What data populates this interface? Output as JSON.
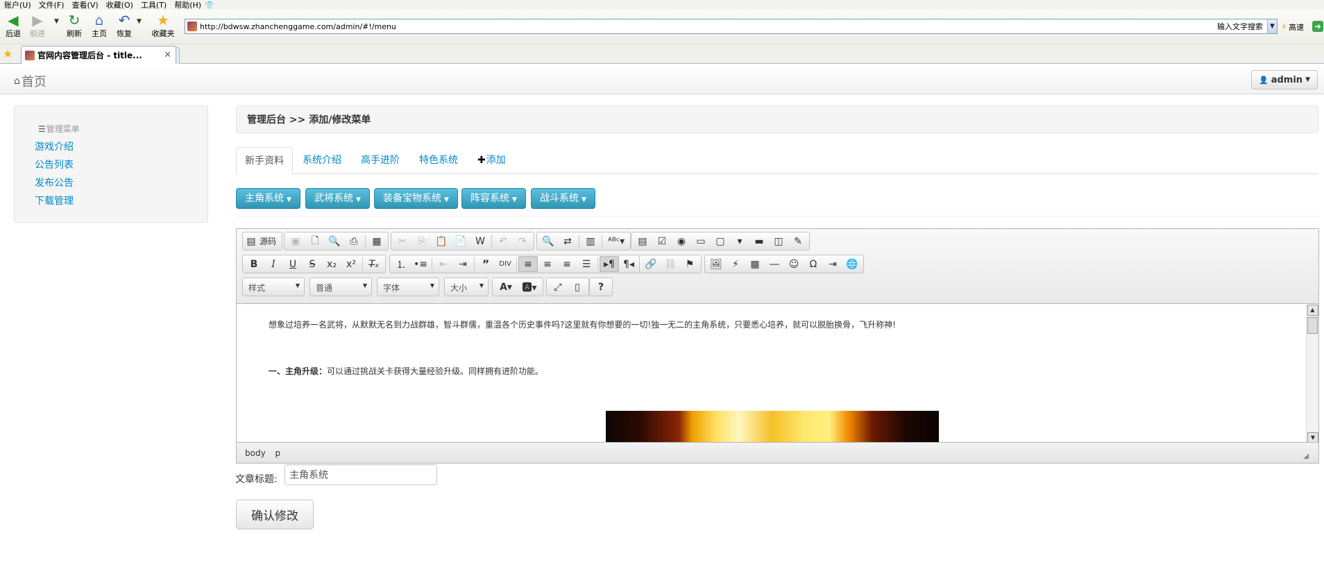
{
  "browser": {
    "menu": [
      "账户(U)",
      "文件(F)",
      "查看(V)",
      "收藏(O)",
      "工具(T)",
      "帮助(H)"
    ],
    "toolbar": {
      "back": "后退",
      "forward": "前进",
      "refresh": "刷新",
      "home": "主页",
      "restore": "恢复",
      "favorites": "收藏夹"
    },
    "address": "http://bdwsw.zhanchenggame.com/admin/#!/menu",
    "search_label": "输入文字搜索",
    "speed_label": "高速",
    "tab_title": "官网内容管理后台 - title..."
  },
  "navbar": {
    "brand": "首页",
    "user": "admin"
  },
  "sidebar": {
    "header": "管理菜单",
    "items": [
      "游戏介绍",
      "公告列表",
      "发布公告",
      "下载管理"
    ]
  },
  "breadcrumb": "管理后台 >> 添加/修改菜单",
  "tabs": {
    "items": [
      "新手资料",
      "系统介绍",
      "高手进阶",
      "特色系统"
    ],
    "add": "添加",
    "active": "新手资料"
  },
  "categories": [
    "主角系统",
    "武将系统",
    "装备宝物系统",
    "阵容系统",
    "战斗系统"
  ],
  "editor": {
    "source_label": "源码",
    "combos": {
      "style": "样式",
      "format": "普通",
      "font": "字体",
      "size": "大小"
    },
    "content": {
      "para1": "想象过培养一名武将，从默默无名到力战群雄，智斗群儒，重温各个历史事件吗?这里就有你想要的一切!独一无二的主角系统，只要悉心培养，就可以脱胎换骨，飞升称神!",
      "para2_bold": "一、主角升级：",
      "para2_text": "可以通过挑战关卡获得大量经验升级。同样拥有进阶功能。"
    },
    "path": [
      "body",
      "p"
    ]
  },
  "form": {
    "title_label": "文章标题:",
    "title_value": "主角系统",
    "submit": "确认修改"
  },
  "colors": {
    "link": "#0088cc",
    "info_button": "#2f96b4",
    "brand_text": "#777777"
  }
}
